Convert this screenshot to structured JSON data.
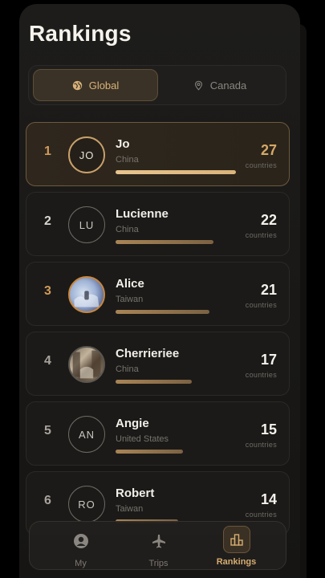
{
  "header": {
    "title": "Rankings"
  },
  "segments": [
    {
      "label": "Global",
      "icon": "globe-icon",
      "active": true
    },
    {
      "label": "Canada",
      "icon": "location-pin-icon",
      "active": false
    }
  ],
  "rankings": [
    {
      "rank": "1",
      "initials": "JO",
      "name": "Jo",
      "country": "China",
      "count": "27",
      "count_label": "countries",
      "progress": 1.0
    },
    {
      "rank": "2",
      "initials": "LU",
      "name": "Lucienne",
      "country": "China",
      "count": "22",
      "count_label": "countries",
      "progress": 0.81
    },
    {
      "rank": "3",
      "initials": "",
      "name": "Alice",
      "country": "Taiwan",
      "count": "21",
      "count_label": "countries",
      "progress": 0.78
    },
    {
      "rank": "4",
      "initials": "",
      "name": "Cherrieriee",
      "country": "China",
      "count": "17",
      "count_label": "countries",
      "progress": 0.63
    },
    {
      "rank": "5",
      "initials": "AN",
      "name": "Angie",
      "country": "United States",
      "count": "15",
      "count_label": "countries",
      "progress": 0.56
    },
    {
      "rank": "6",
      "initials": "RO",
      "name": "Robert",
      "country": "Taiwan",
      "count": "14",
      "count_label": "countries",
      "progress": 0.52
    }
  ],
  "tabbar": [
    {
      "label": "My",
      "icon": "user-circle-icon",
      "active": false
    },
    {
      "label": "Trips",
      "icon": "airplane-icon",
      "active": false
    },
    {
      "label": "Rankings",
      "icon": "podium-icon",
      "active": true
    }
  ],
  "colors": {
    "accent": "#d6ad70",
    "background": "#161514",
    "card": "#1b1a18"
  }
}
